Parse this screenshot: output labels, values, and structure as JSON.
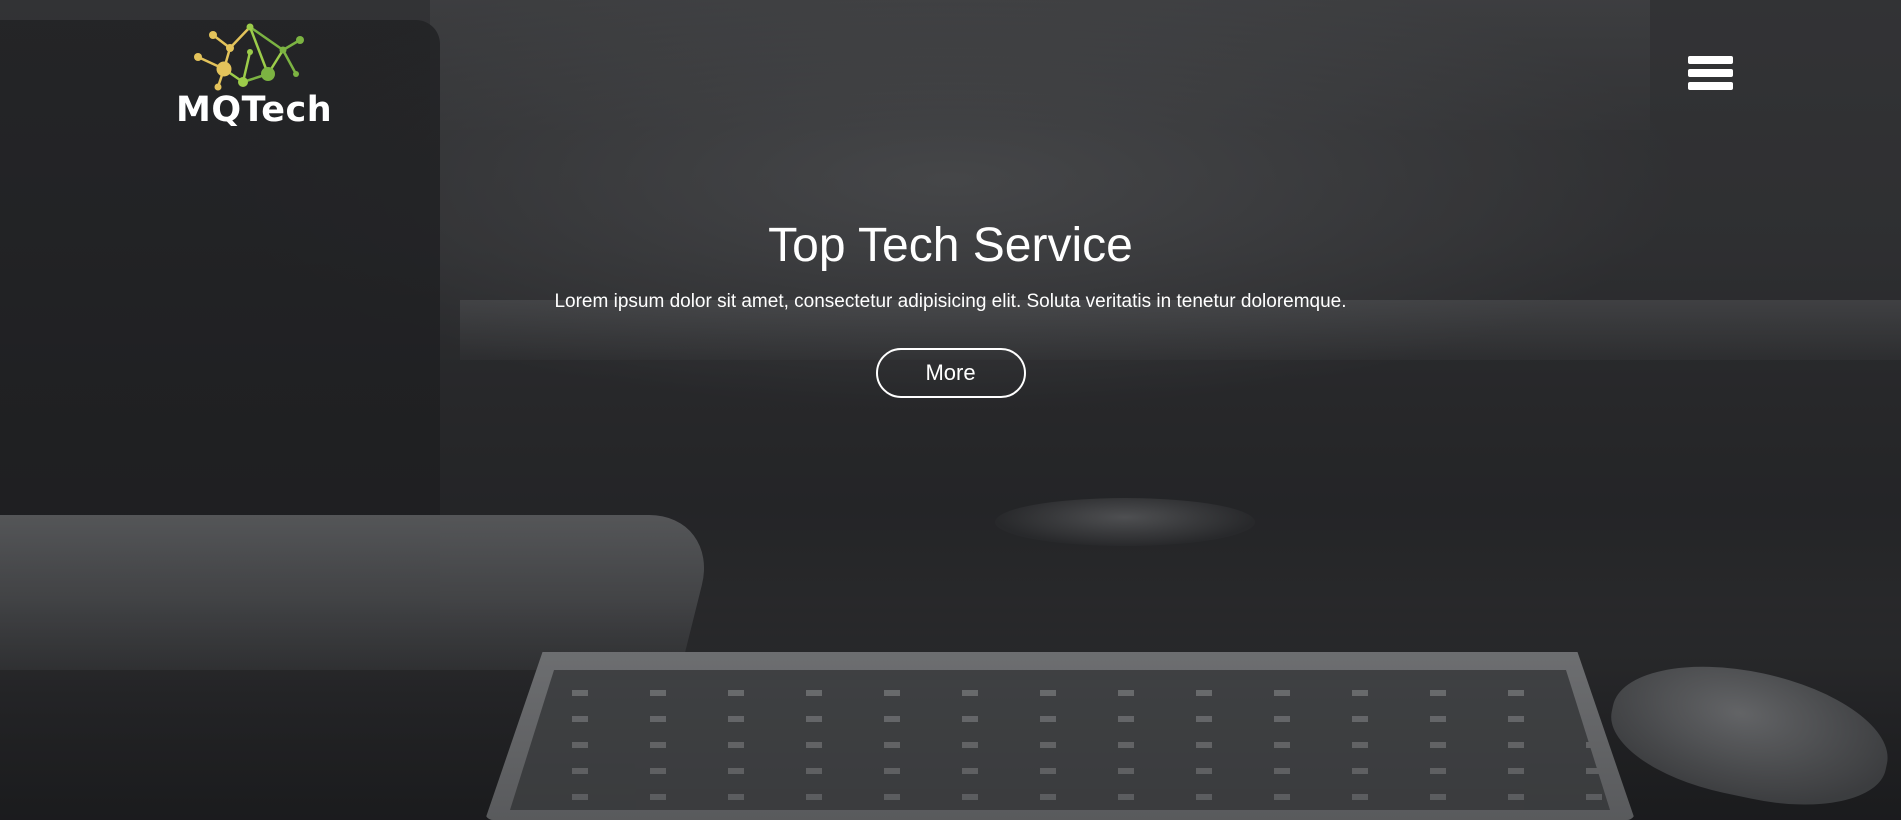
{
  "brand": {
    "name": "MQTech",
    "logo_icon": "molecule-network-icon",
    "colors": {
      "yellow": "#e3c35b",
      "green": "#7cb342",
      "lime": "#9ccc4a"
    }
  },
  "nav": {
    "menu_icon": "hamburger-menu-icon"
  },
  "hero": {
    "title": "Top Tech Service",
    "subtitle": "Lorem ipsum dolor sit amet, consectetur adipisicing elit. Soluta veritatis in tenetur doloremque.",
    "cta_label": "More"
  }
}
